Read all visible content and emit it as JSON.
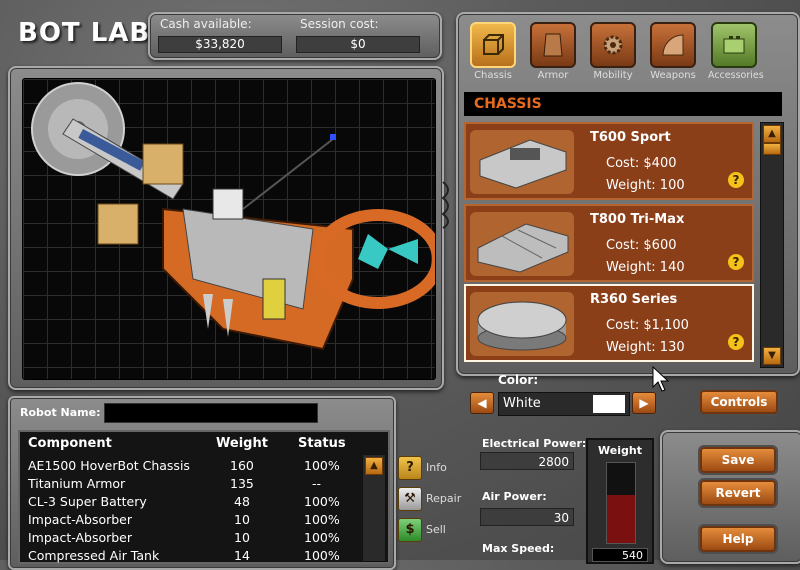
{
  "app": {
    "title": "BOT LAB"
  },
  "cash": {
    "available_label": "Cash available:",
    "available_value": "$33,820",
    "session_label": "Session cost:",
    "session_value": "$0"
  },
  "categories": [
    {
      "label": "Chassis",
      "icon": "chassis-cube-icon",
      "selected": true
    },
    {
      "label": "Armor",
      "icon": "armor-plate-icon",
      "selected": false
    },
    {
      "label": "Mobility",
      "icon": "gear-icon",
      "selected": false
    },
    {
      "label": "Weapons",
      "icon": "saw-blade-icon",
      "selected": false
    },
    {
      "label": "Accessories",
      "icon": "battery-icon",
      "selected": false
    }
  ],
  "section_heading": "CHASSIS",
  "parts": [
    {
      "name": "T600 Sport",
      "cost": "Cost: $400",
      "weight": "Weight: 100",
      "selected": false
    },
    {
      "name": "T800 Tri-Max",
      "cost": "Cost: $600",
      "weight": "Weight: 140",
      "selected": false
    },
    {
      "name": "R360 Series",
      "cost": "Cost: $1,100",
      "weight": "Weight: 130",
      "selected": true
    }
  ],
  "color": {
    "label": "Color:",
    "value": "White",
    "swatch": "#ffffff"
  },
  "buttons": {
    "controls": "Controls",
    "save": "Save",
    "revert": "Revert",
    "help": "Help"
  },
  "robot_name": {
    "label": "Robot Name:",
    "value": ""
  },
  "components": {
    "headers": {
      "component": "Component",
      "weight": "Weight",
      "status": "Status"
    },
    "rows": [
      {
        "component": "AE1500 HoverBot Chassis",
        "weight": "160",
        "status": "100%"
      },
      {
        "component": "Titanium Armor",
        "weight": "135",
        "status": "--"
      },
      {
        "component": "CL-3 Super Battery",
        "weight": "48",
        "status": "100%"
      },
      {
        "component": "Impact-Absorber",
        "weight": "10",
        "status": "100%"
      },
      {
        "component": "Impact-Absorber",
        "weight": "10",
        "status": "100%"
      },
      {
        "component": "Compressed Air Tank",
        "weight": "14",
        "status": "100%"
      }
    ]
  },
  "actions": [
    {
      "label": "Info",
      "glyph": "?"
    },
    {
      "label": "Repair",
      "glyph": "⚒"
    },
    {
      "label": "Sell",
      "glyph": "$"
    }
  ],
  "stats": {
    "electrical_label": "Electrical Power:",
    "electrical_value": "2800",
    "air_label": "Air Power:",
    "air_value": "30",
    "speed_label": "Max Speed:"
  },
  "weight_meter": {
    "label": "Weight",
    "fill_fraction": 0.6,
    "value": "540"
  },
  "colors": {
    "accent_orange": "#e76b1e",
    "part_bg": "#8a3f19",
    "meter_fill": "#7a1010"
  }
}
